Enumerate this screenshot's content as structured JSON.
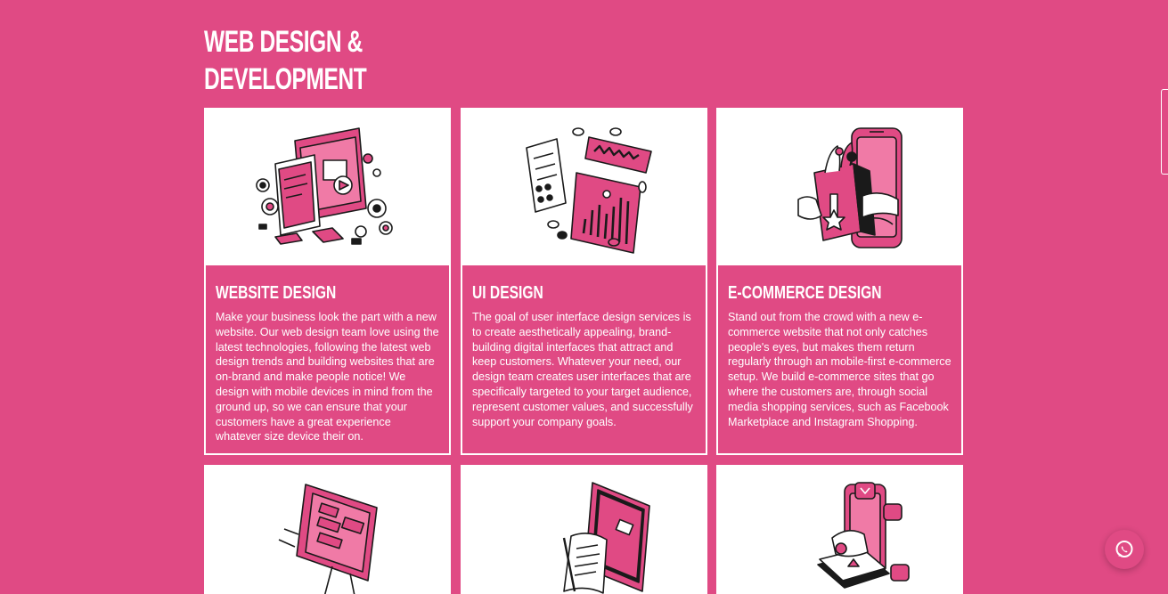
{
  "section": {
    "title_line1": "WEB DESIGN &",
    "title_line2": "DEVELOPMENT"
  },
  "cards": [
    {
      "title": "WEBSITE DESIGN",
      "icon": "website-design-illustration",
      "text": "Make your business look the part with a new website. Our web design team love using the latest technologies, following the latest web design trends and building websites that are on-brand and make people notice! We design with mobile devices in mind from the ground up, so we can ensure that your customers have a great experience whatever size device their on."
    },
    {
      "title": "UI DESIGN",
      "icon": "ui-design-illustration",
      "text": "The goal of user interface design services is to create aesthetically appealing, brand-building digital interfaces that attract and keep customers. Whatever your need, our design team creates user interfaces that are specifically targeted to your target audience, represent customer values, and successfully support your company goals."
    },
    {
      "title": "E-COMMERCE DESIGN",
      "icon": "ecommerce-design-illustration",
      "text": "Stand out from the crowd with a new e-commerce website that not only catches people's eyes, but makes them return regularly through an mobile-first e-commerce setup. We build e-commerce sites that go where the customers are, through social media shopping services, such as Facebook Marketplace and Instagram Shopping."
    }
  ],
  "second_row_icons": [
    "web-development-illustration",
    "content-illustration",
    "social-media-illustration"
  ],
  "floating": {
    "icon": "whatsapp-icon"
  },
  "colors": {
    "brand_pink": "#e04a84",
    "ink": "#1a1a1a",
    "white": "#ffffff"
  }
}
